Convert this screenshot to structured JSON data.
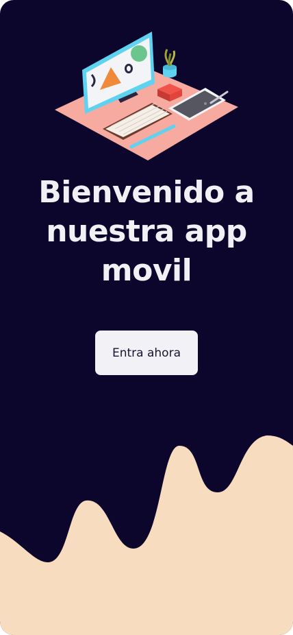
{
  "welcome": {
    "title": "Bienvenido a nuestra app movil",
    "cta_label": "Entra ahora"
  },
  "colors": {
    "background": "#0d062c",
    "title_text": "#f1f1f5",
    "button_bg": "#f2f2f6",
    "button_text": "#17142e",
    "wave": "#f8dcc0",
    "desk": "#f6aaa0"
  },
  "icons": {
    "hero": "workspace-illustration"
  }
}
